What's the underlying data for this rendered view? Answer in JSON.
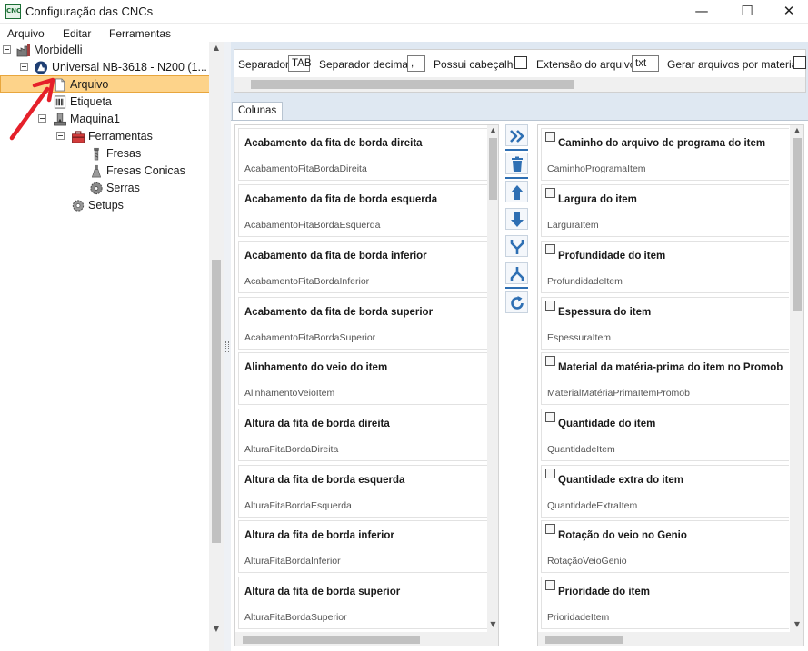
{
  "window": {
    "title": "Configuração das CNCs",
    "app_icon_text": "CNC",
    "minimize": "—",
    "maximize": "☐",
    "close": "✕"
  },
  "menu": {
    "items": [
      "Arquivo",
      "Editar",
      "Ferramentas"
    ]
  },
  "tree": {
    "root": "Morbidelli",
    "machine_model": "Universal NB-3618 - N200 (1...",
    "arquivo": "Arquivo",
    "etiqueta": "Etiqueta",
    "maquina": "Maquina1",
    "ferramentas": "Ferramentas",
    "fresas": "Fresas",
    "fresas_conicas": "Fresas Conicas",
    "serras": "Serras",
    "setups": "Setups",
    "selected": "Arquivo"
  },
  "options": {
    "separador_label": "Separador",
    "separador_value": "TAB",
    "separador_decimal_label": "Separador decimal",
    "separador_decimal_value": ",",
    "possui_cabecalho_label": "Possui cabeçalho",
    "extensao_label": "Extensão do arquivo",
    "extensao_value": "txt",
    "gerar_label": "Gerar arquivos por material"
  },
  "tabs": {
    "colunas": "Colunas"
  },
  "available_columns": [
    {
      "title": "Acabamento da fita de borda direita",
      "field": "AcabamentoFitaBordaDireita"
    },
    {
      "title": "Acabamento da fita de borda esquerda",
      "field": "AcabamentoFitaBordaEsquerda"
    },
    {
      "title": "Acabamento da fita de borda inferior",
      "field": "AcabamentoFitaBordaInferior"
    },
    {
      "title": "Acabamento da fita de borda superior",
      "field": "AcabamentoFitaBordaSuperior"
    },
    {
      "title": "Alinhamento do veio do item",
      "field": "AlinhamentoVeioItem"
    },
    {
      "title": "Altura da fita de borda direita",
      "field": "AlturaFitaBordaDireita"
    },
    {
      "title": "Altura da fita de borda esquerda",
      "field": "AlturaFitaBordaEsquerda"
    },
    {
      "title": "Altura da fita de borda inferior",
      "field": "AlturaFitaBordaInferior"
    },
    {
      "title": "Altura da fita de borda superior",
      "field": "AlturaFitaBordaSuperior"
    }
  ],
  "selected_columns": [
    {
      "title": "Caminho do arquivo de programa do item",
      "field": "CaminhoProgramaItem"
    },
    {
      "title": "Largura do item",
      "field": "LarguraItem"
    },
    {
      "title": "Profundidade do item",
      "field": "ProfundidadeItem"
    },
    {
      "title": "Espessura do item",
      "field": "EspessuraItem"
    },
    {
      "title": "Material da matéria-prima do item no Promob",
      "field": "MaterialMatériaPrimaItemPromob"
    },
    {
      "title": "Quantidade do item",
      "field": "QuantidadeItem"
    },
    {
      "title": "Quantidade extra do item",
      "field": "QuantidadeExtraItem"
    },
    {
      "title": "Rotação do veio no Genio",
      "field": "RotaçãoVeioGenio"
    },
    {
      "title": "Prioridade do item",
      "field": "PrioridadeItem"
    }
  ],
  "colors": {
    "selection_fill": "#fdd38a",
    "selection_border": "#e8a63d",
    "tool_blue": "#2e6fb3",
    "annotation_red": "#e5202a"
  }
}
